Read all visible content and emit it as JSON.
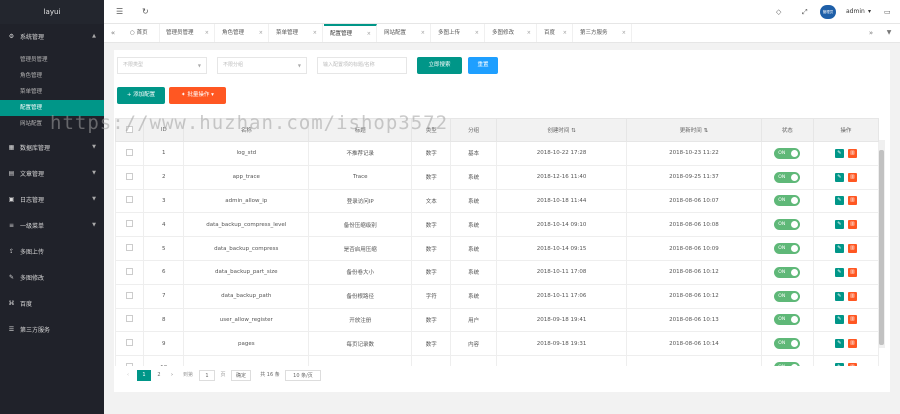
{
  "app": {
    "logo": "layui"
  },
  "sidebar": {
    "groups": [
      {
        "label": "系统管理",
        "icon": "gear-icon"
      },
      {
        "label": "数据库管理",
        "icon": "database-icon"
      },
      {
        "label": "文章管理",
        "icon": "file-icon"
      },
      {
        "label": "日志管理",
        "icon": "log-icon"
      },
      {
        "label": "一级菜单",
        "icon": "menu-icon"
      },
      {
        "label": "多图上传",
        "icon": "upload-icon"
      },
      {
        "label": "多图修改",
        "icon": "edit-icon"
      },
      {
        "label": "百度",
        "icon": "link-icon"
      },
      {
        "label": "第三方服务",
        "icon": "service-icon"
      }
    ],
    "subitems": [
      "管理员管理",
      "角色管理",
      "菜单管理",
      "配置管理",
      "网站配置"
    ]
  },
  "header": {
    "user_avatar": "管理员",
    "user_name": "admin",
    "user_caret": "▾"
  },
  "tabs": [
    "首页",
    "管理员管理",
    "角色管理",
    "菜单管理",
    "配置管理",
    "网站配置",
    "多图上传",
    "多图修改",
    "百度",
    "第三方服务"
  ],
  "filters": {
    "type_placeholder": "不限类型",
    "group_placeholder": "不限分组",
    "search_placeholder": "输入配置项的标题/名称",
    "search_button": "立即搜索",
    "reset_button": "重置"
  },
  "toolbar": {
    "add_button": "+ 添加配置",
    "batch_button": "批量操作"
  },
  "table": {
    "headers": [
      "",
      "ID",
      "名称",
      "标题",
      "类型",
      "分组",
      "创建时间",
      "更新时间",
      "状态",
      "操作"
    ],
    "rows": [
      [
        "1",
        "log_std",
        "不推荐记录",
        "数字",
        "基本",
        "2018-10-22 17:28",
        "2018-10-23 11:22"
      ],
      [
        "2",
        "app_trace",
        "Trace",
        "数字",
        "系统",
        "2018-12-16 11:40",
        "2018-09-25 11:37"
      ],
      [
        "3",
        "admin_allow_ip",
        "登录访问IP",
        "文本",
        "系统",
        "2018-10-18 11:44",
        "2018-08-06 10:07"
      ],
      [
        "4",
        "data_backup_compress_level",
        "备份压缩级别",
        "数字",
        "系统",
        "2018-10-14 09:10",
        "2018-08-06 10:08"
      ],
      [
        "5",
        "data_backup_compress",
        "是否启用压缩",
        "数字",
        "系统",
        "2018-10-14 09:15",
        "2018-08-06 10:09"
      ],
      [
        "6",
        "data_backup_part_size",
        "备份卷大小",
        "数字",
        "系统",
        "2018-10-11 17:08",
        "2018-08-06 10:12"
      ],
      [
        "7",
        "data_backup_path",
        "备份根路径",
        "字符",
        "系统",
        "2018-10-11 17:06",
        "2018-08-06 10:12"
      ],
      [
        "8",
        "user_allow_register",
        "开放注册",
        "数字",
        "用户",
        "2018-09-18 19:41",
        "2018-08-06 10:13"
      ],
      [
        "9",
        "pages",
        "每页记录数",
        "数字",
        "内容",
        "2018-09-18 19:31",
        "2018-08-06 10:14"
      ],
      [
        "10",
        "",
        "",
        "",
        "",
        "",
        ""
      ]
    ],
    "status_label": "ON"
  },
  "pagination": {
    "pages": [
      "1",
      "2"
    ],
    "goto_label": "到第",
    "goto_value": "1",
    "page_unit": "页",
    "confirm": "确定",
    "total": "共 16 条",
    "per_page": "10 条/页"
  },
  "watermark": "https://www.huzhan.com/ishop3572",
  "colors": {
    "sidebar": "#20222a",
    "accent": "#009688",
    "blue": "#1e9fff",
    "warm": "#ff5722",
    "switch_on": "#5fb878"
  }
}
